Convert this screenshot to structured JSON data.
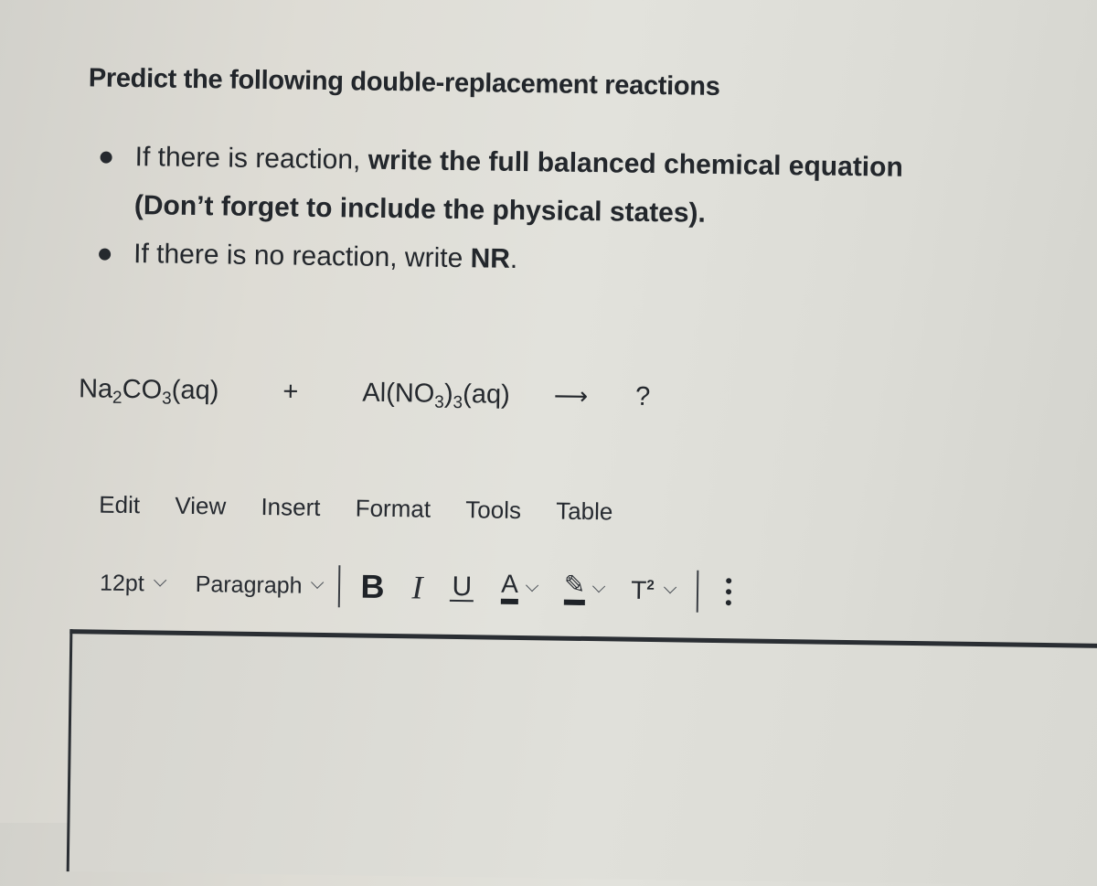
{
  "question": {
    "title": "Predict the following double-replacement reactions",
    "bullets": [
      {
        "plain": "If there is reaction, ",
        "bold": "write the full balanced chemical equation  (Don’t forget to include the physical states).",
        "after": ""
      },
      {
        "plain": "If there is no reaction, write ",
        "bold": "NR",
        "after": "."
      }
    ]
  },
  "equation": {
    "reactant1": {
      "a": "Na",
      "s1": "2",
      "b": "CO",
      "s2": "3",
      "c": "(aq)"
    },
    "plus": "+",
    "reactant2": {
      "a": "Al(NO",
      "s1": "3",
      "b": ")",
      "s2": "3",
      "c": "(aq)"
    },
    "arrow": "⟶",
    "product": "?"
  },
  "editor": {
    "menu": [
      "Edit",
      "View",
      "Insert",
      "Format",
      "Tools",
      "Table"
    ],
    "toolbar": {
      "font_size": "12pt",
      "block_format": "Paragraph",
      "bold": "B",
      "italic": "I",
      "underline": "U",
      "text_color": "A",
      "highlight": "✎",
      "superscript": "T",
      "superscript_mark": "2"
    },
    "content": ""
  }
}
